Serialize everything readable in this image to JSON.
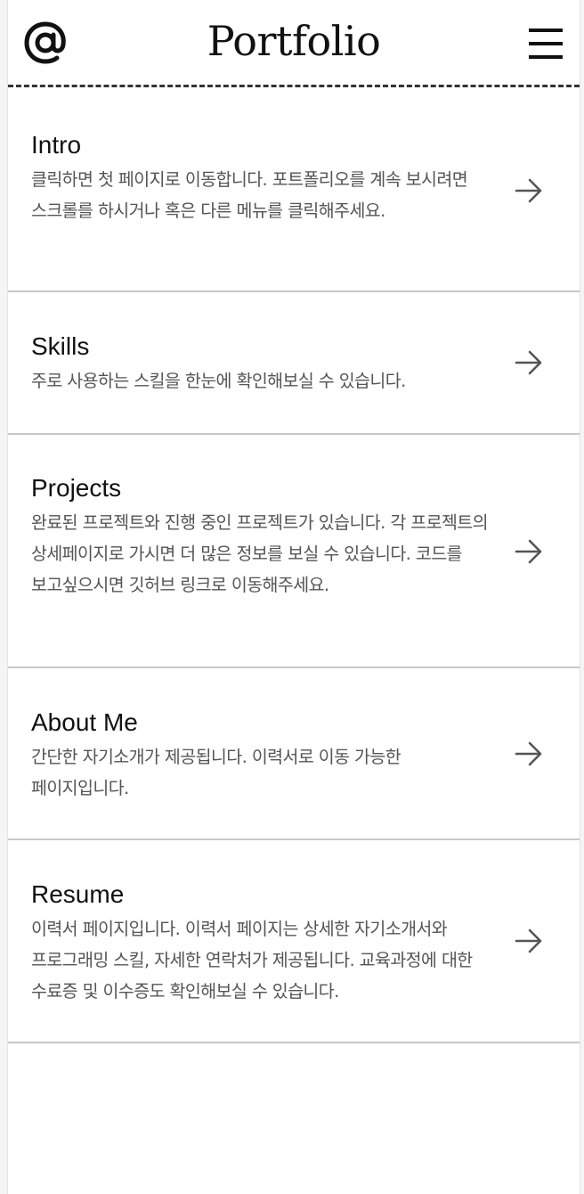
{
  "header": {
    "logo_icon": "at-sign-icon",
    "title": "Portfolio",
    "menu_icon": "hamburger-menu-icon"
  },
  "menu": {
    "items": [
      {
        "title": "Intro",
        "description": "클릭하면 첫 페이지로 이동합니다. 포트폴리오를 계속 보시려면 스크롤를 하시거나 혹은 다른 메뉴를 클릭해주세요.",
        "icon": "arrow-right-icon"
      },
      {
        "title": "Skills",
        "description": "주로 사용하는 스킬을 한눈에 확인해보실 수 있습니다.",
        "icon": "arrow-right-icon"
      },
      {
        "title": "Projects",
        "description": "완료된 프로젝트와 진행 중인 프로젝트가 있습니다. 각 프로젝트의 상세페이지로 가시면 더 많은 정보를 보실 수 있습니다. 코드를 보고싶으시면 깃허브 링크로 이동해주세요.",
        "icon": "arrow-right-icon"
      },
      {
        "title": "About Me",
        "description": "간단한 자기소개가 제공됩니다. 이력서로 이동 가능한 페이지입니다.",
        "icon": "arrow-right-icon"
      },
      {
        "title": "Resume",
        "description": "이력서 페이지입니다. 이력서 페이지는 상세한 자기소개서와 프로그래밍 스킬, 자세한 연락처가 제공됩니다. 교육과정에 대한 수료증 및 이수증도 확인해보실 수 있습니다.",
        "icon": "arrow-right-icon"
      }
    ]
  },
  "colors": {
    "background": "#ffffff",
    "text": "#111111",
    "muted_text": "#555555",
    "divider": "#c8c8c8",
    "header_border": "#333333"
  }
}
